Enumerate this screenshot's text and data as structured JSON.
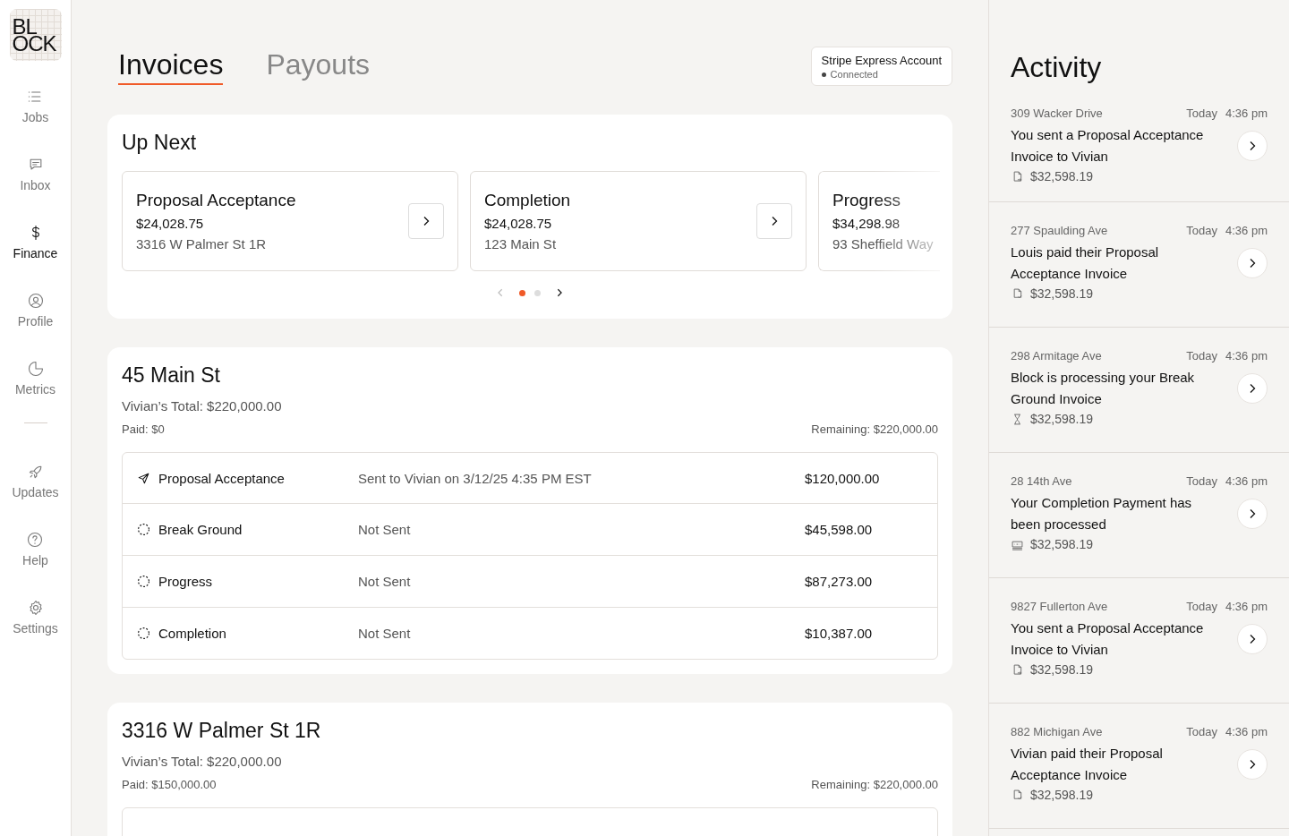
{
  "logo": [
    "BL",
    "OCK"
  ],
  "sidebar": {
    "items": [
      {
        "label": "Jobs",
        "kind": "list",
        "selected": false
      },
      {
        "label": "Inbox",
        "kind": "chat",
        "selected": false
      },
      {
        "label": "Finance",
        "kind": "dollar",
        "selected": true
      },
      {
        "label": "Profile",
        "kind": "user",
        "selected": false
      },
      {
        "label": "Metrics",
        "kind": "pie",
        "selected": false
      }
    ],
    "bottom_items": [
      {
        "label": "Updates",
        "kind": "rocket",
        "selected": false
      },
      {
        "label": "Help",
        "kind": "help",
        "selected": false
      },
      {
        "label": "Settings",
        "kind": "gear",
        "selected": false
      }
    ]
  },
  "tabs": [
    {
      "label": "Invoices",
      "selected": true
    },
    {
      "label": "Payouts",
      "selected": false
    }
  ],
  "account": {
    "title": "Stripe Express Account",
    "status": "Connected"
  },
  "up_next": {
    "title": "Up Next",
    "cards": [
      {
        "title": "Proposal Acceptance",
        "amount": "$24,028.75",
        "address": "3316 W Palmer St 1R"
      },
      {
        "title": "Completion",
        "amount": "$24,028.75",
        "address": "123 Main St"
      },
      {
        "title": "Progress",
        "amount": "$34,298.98",
        "address": "93 Sheffield Way",
        "faded": true
      }
    ],
    "pager": [
      {
        "selected": true
      },
      {
        "selected": false
      }
    ],
    "prev_disabled": true
  },
  "properties": [
    {
      "title": "45 Main St",
      "total": "Vivian’s Total: $220,000.00",
      "paid": "Paid: $0",
      "remaining": "Remaining: $220,000.00",
      "invoices": [
        {
          "kind": "sent",
          "name": "Proposal Acceptance",
          "status": "Sent to Vivian on 3/12/25 4:35 PM EST",
          "amount": "$120,000.00"
        },
        {
          "kind": "not_sent",
          "name": "Break Ground",
          "status": "Not Sent",
          "amount": "$45,598.00"
        },
        {
          "kind": "not_sent",
          "name": "Progress",
          "status": "Not Sent",
          "amount": "$87,273.00"
        },
        {
          "kind": "not_sent",
          "name": "Completion",
          "status": "Not Sent",
          "amount": "$10,387.00"
        }
      ]
    },
    {
      "title": "3316 W Palmer St 1R",
      "total": "Vivian’s Total: $220,000.00",
      "paid": "Paid: $150,000.00",
      "remaining": "Remaining: $220,000.00"
    }
  ],
  "activity": {
    "title": "Activity",
    "items": [
      {
        "address": "309 Wacker Drive",
        "day": "Today",
        "time": "4:36 pm",
        "message": "You sent a Proposal Acceptance Invoice to Vivian",
        "kind": "sent",
        "amount": "$32,598.19"
      },
      {
        "address": "277 Spaulding Ave",
        "day": "Today",
        "time": "4:36 pm",
        "message": "Louis paid their Proposal Acceptance Invoice",
        "kind": "paid",
        "amount": "$32,598.19"
      },
      {
        "address": "298 Armitage Ave",
        "day": "Today",
        "time": "4:36 pm",
        "message": "Block is processing your Break Ground Invoice",
        "kind": "processing",
        "amount": "$32,598.19"
      },
      {
        "address": "28 14th Ave",
        "day": "Today",
        "time": "4:36 pm",
        "message": "Your Completion Payment has been processed",
        "kind": "processed",
        "amount": "$32,598.19"
      },
      {
        "address": "9827 Fullerton Ave",
        "day": "Today",
        "time": "4:36 pm",
        "message": "You sent a Proposal Acceptance Invoice to Vivian",
        "kind": "sent",
        "amount": "$32,598.19"
      },
      {
        "address": "882 Michigan Ave",
        "day": "Today",
        "time": "4:36 pm",
        "message": "Vivian paid their Proposal Acceptance Invoice",
        "kind": "paid",
        "amount": "$32,598.19"
      }
    ]
  }
}
